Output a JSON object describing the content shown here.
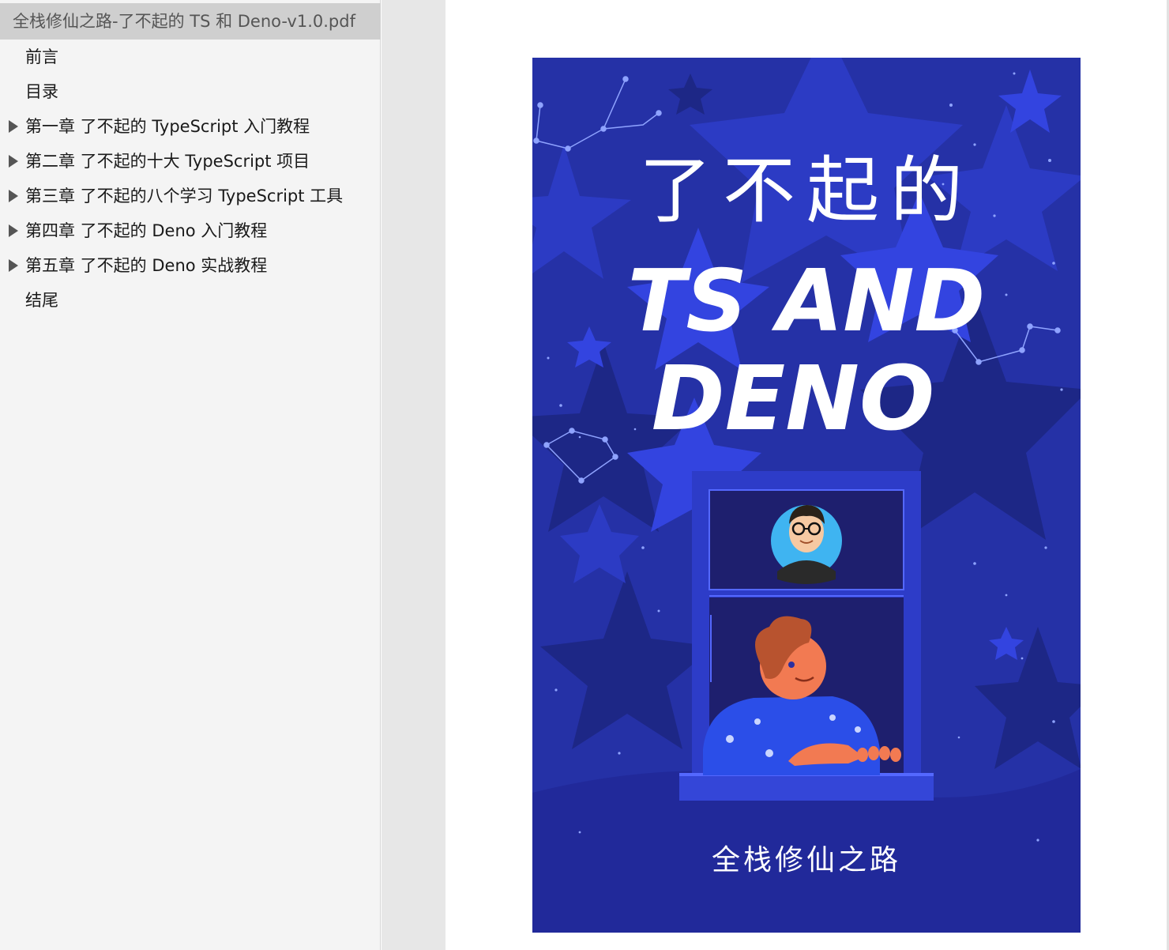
{
  "sidebar": {
    "document_title": "全栈修仙之路-了不起的 TS 和 Deno-v1.0.pdf",
    "items": [
      {
        "label": "前言",
        "expandable": false
      },
      {
        "label": "目录",
        "expandable": false
      },
      {
        "label": "第一章 了不起的 TypeScript 入门教程",
        "expandable": true
      },
      {
        "label": "第二章 了不起的十大 TypeScript 项目",
        "expandable": true
      },
      {
        "label": "第三章 了不起的八个学习 TypeScript 工具",
        "expandable": true
      },
      {
        "label": "第四章 了不起的 Deno 入门教程",
        "expandable": true
      },
      {
        "label": "第五章 了不起的 Deno 实战教程",
        "expandable": true
      },
      {
        "label": "结尾",
        "expandable": false
      }
    ]
  },
  "cover": {
    "title_cn": "了不起的",
    "title_line1": "TS AND",
    "title_line2": "DENO",
    "author": "全栈修仙之路",
    "colors": {
      "background": "#2531a6",
      "star_light": "#2f3fd2",
      "star_dark": "#1c2479",
      "title_text": "#ffffff"
    }
  },
  "icons": {
    "disclosure": "disclosure-triangle-icon"
  }
}
